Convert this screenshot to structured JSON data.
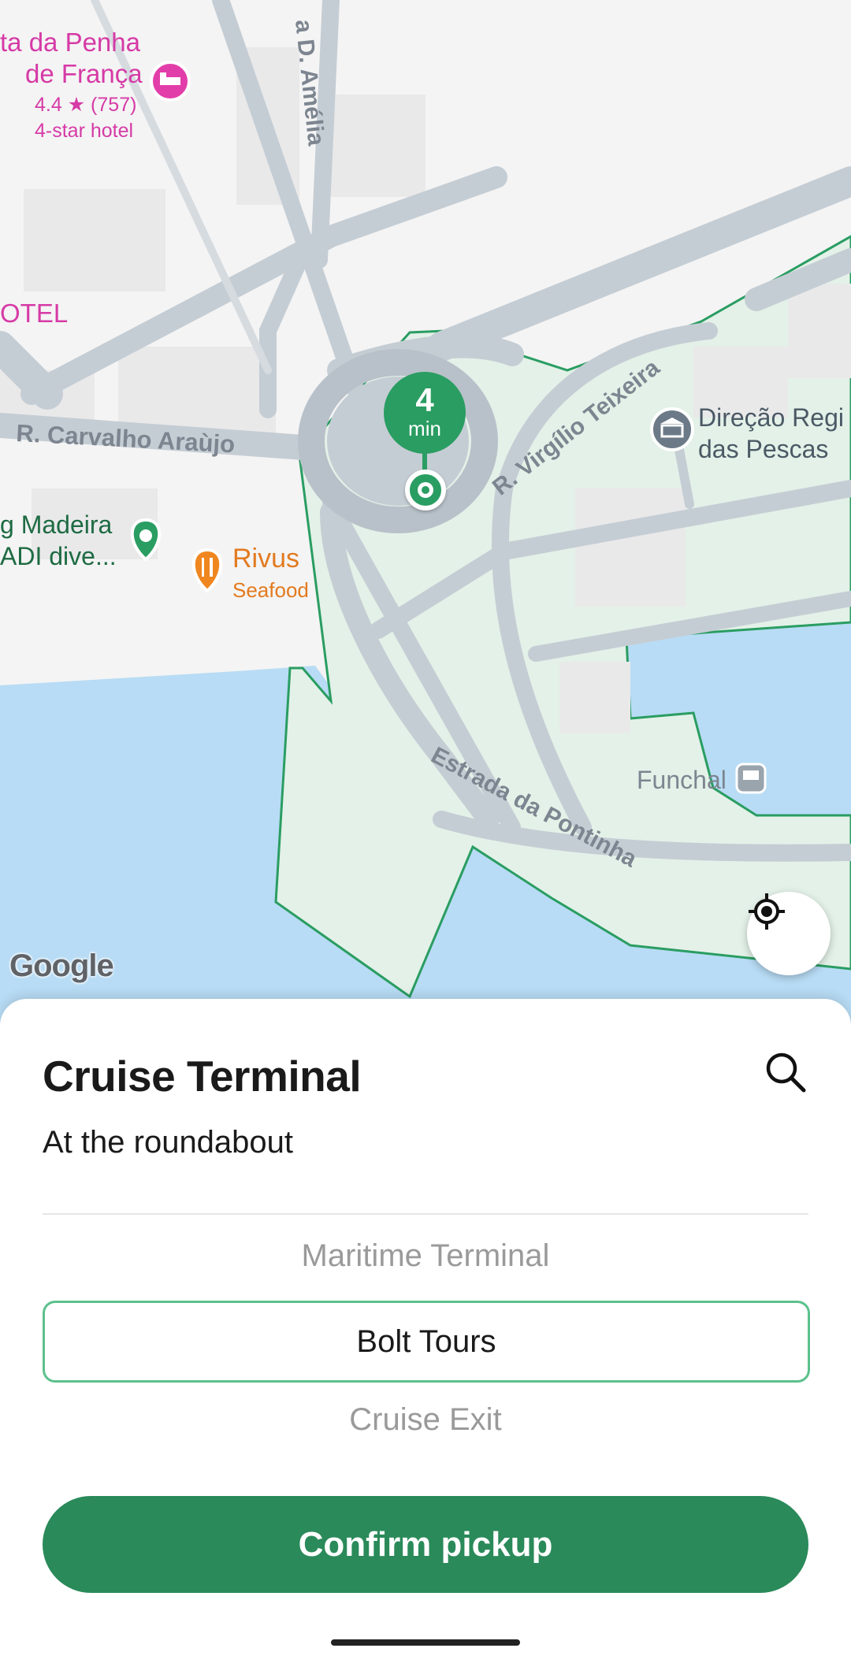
{
  "map": {
    "streets": {
      "carvalho": "R. Carvalho Araùjo",
      "amelia": "a D. Amélia",
      "virgilio": "R. Virgílio Teixeira",
      "pontinha": "Estrada da Pontinha"
    },
    "hotel": {
      "name_line1": "ta da Penha",
      "name_line2": "de França",
      "rating": "4.4 ★ (757)",
      "category": "4-star hotel"
    },
    "hotel_partial": "OTEL",
    "dive_poi": {
      "line1": "g Madeira",
      "line2": "ADI dive..."
    },
    "restaurant": {
      "name": "Rivus",
      "category": "Seafood"
    },
    "gov_poi": {
      "line1": "Direção Regi",
      "line2": "das Pescas"
    },
    "funchal_label": "Funchal",
    "pickup_pin": {
      "eta_value": "4",
      "eta_unit": "min"
    },
    "attribution": "Google",
    "colors": {
      "zone_fill": "#e3f1e8",
      "zone_stroke": "#2a9d62",
      "water": "#b8dcf5",
      "roads": "#c5cdd4"
    }
  },
  "sheet": {
    "title": "Cruise Terminal",
    "subtitle": "At the roundabout",
    "options": [
      {
        "label": "Maritime Terminal",
        "selected": false
      },
      {
        "label": "Bolt Tours",
        "selected": true
      },
      {
        "label": "Cruise Exit",
        "selected": false
      }
    ],
    "confirm_label": "Confirm pickup",
    "accent": "#2a8a5a"
  },
  "icons": {
    "search": "search-icon",
    "locate": "my-location-icon",
    "hotel": "hotel-bed-icon",
    "restaurant": "fork-knife-icon",
    "government": "government-building-icon",
    "bus": "bus-icon"
  }
}
